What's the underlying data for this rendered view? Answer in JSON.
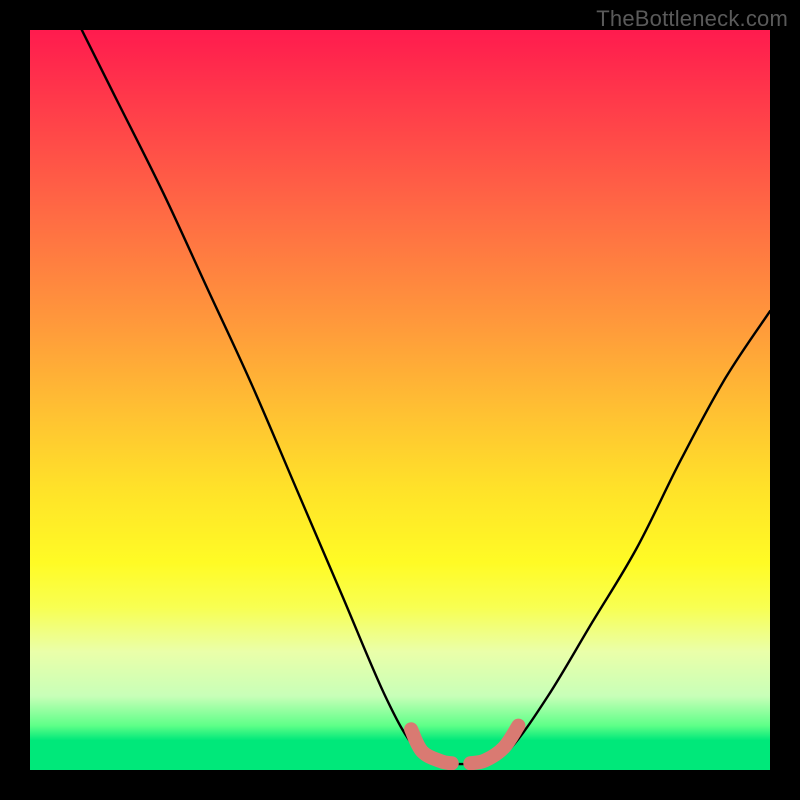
{
  "watermark": "TheBottleneck.com",
  "chart_data": {
    "type": "line",
    "title": "",
    "xlabel": "",
    "ylabel": "",
    "xlim": [
      0,
      100
    ],
    "ylim": [
      0,
      100
    ],
    "series": [
      {
        "name": "bottleneck-curve",
        "points": [
          {
            "x": 7,
            "y": 100
          },
          {
            "x": 12,
            "y": 90
          },
          {
            "x": 18,
            "y": 78
          },
          {
            "x": 24,
            "y": 65
          },
          {
            "x": 30,
            "y": 52
          },
          {
            "x": 36,
            "y": 38
          },
          {
            "x": 42,
            "y": 24
          },
          {
            "x": 48,
            "y": 10
          },
          {
            "x": 52,
            "y": 3
          },
          {
            "x": 55,
            "y": 1.2
          },
          {
            "x": 58,
            "y": 0.8
          },
          {
            "x": 62,
            "y": 1.2
          },
          {
            "x": 65,
            "y": 3
          },
          {
            "x": 70,
            "y": 10
          },
          {
            "x": 76,
            "y": 20
          },
          {
            "x": 82,
            "y": 30
          },
          {
            "x": 88,
            "y": 42
          },
          {
            "x": 94,
            "y": 53
          },
          {
            "x": 100,
            "y": 62
          }
        ]
      },
      {
        "name": "bottom-marker-left",
        "points": [
          {
            "x": 51.5,
            "y": 5.5
          },
          {
            "x": 53.0,
            "y": 2.5
          },
          {
            "x": 55.5,
            "y": 1.2
          },
          {
            "x": 57.0,
            "y": 0.9
          }
        ]
      },
      {
        "name": "bottom-marker-right",
        "points": [
          {
            "x": 59.5,
            "y": 0.9
          },
          {
            "x": 61.5,
            "y": 1.3
          },
          {
            "x": 64.0,
            "y": 3.0
          },
          {
            "x": 66.0,
            "y": 6.0
          }
        ]
      }
    ]
  }
}
